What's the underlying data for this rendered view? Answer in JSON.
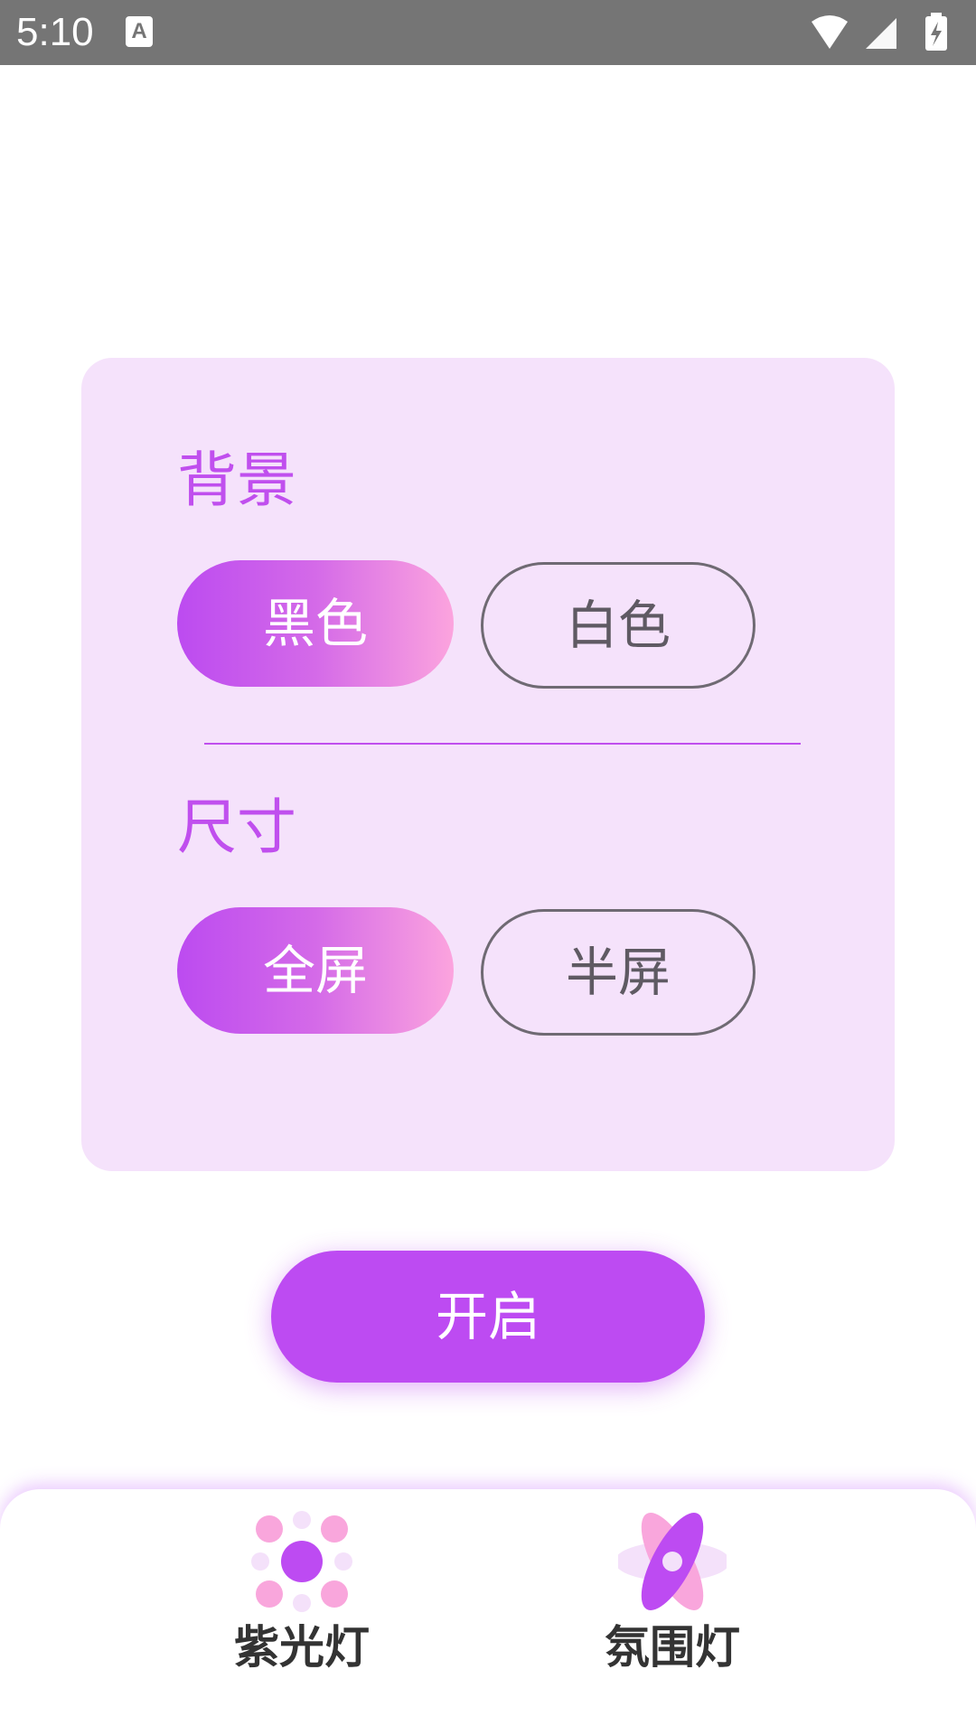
{
  "status_bar": {
    "time": "5:10",
    "notification_icon_letter": "A"
  },
  "card": {
    "background_section": {
      "title": "背景",
      "options": [
        "黑色",
        "白色"
      ],
      "selected": "黑色"
    },
    "size_section": {
      "title": "尺寸",
      "options": [
        "全屏",
        "半屏"
      ],
      "selected": "全屏"
    }
  },
  "start_button": {
    "label": "开启"
  },
  "bottom_nav": {
    "items": [
      {
        "label": "紫光灯",
        "icon": "purple-light-icon"
      },
      {
        "label": "氛围灯",
        "icon": "ambient-light-icon"
      }
    ]
  },
  "colors": {
    "accent": "#bd4bf2",
    "gradient_end": "#fca4de",
    "card_background": "#f5e2fb",
    "status_bar": "#757575"
  }
}
